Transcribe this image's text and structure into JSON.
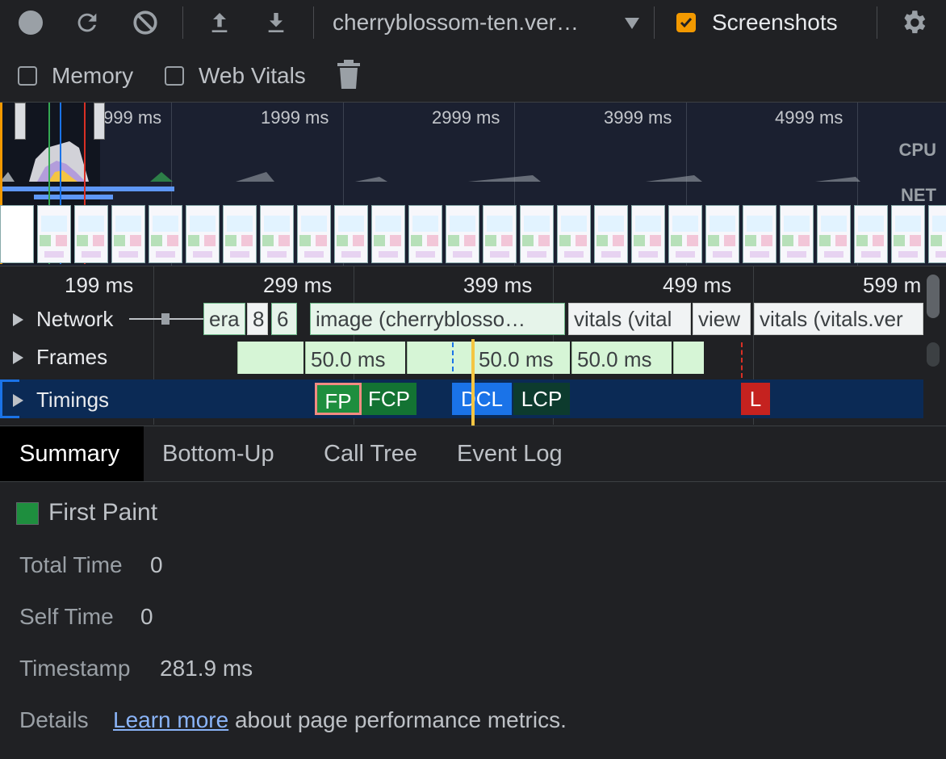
{
  "toolbar": {
    "record_icon": "record-icon",
    "reload_icon": "reload-icon",
    "clear_icon": "clear-icon",
    "upload_icon": "upload-icon",
    "download_icon": "download-icon",
    "profile_select": "cherryblossom-ten.ver…",
    "screenshots_label": "Screenshots",
    "screenshots_checked": true,
    "settings_icon": "gear-icon"
  },
  "toolbar2": {
    "memory_label": "Memory",
    "memory_checked": false,
    "webvitals_label": "Web Vitals",
    "webvitals_checked": false,
    "trash_icon": "trash-icon"
  },
  "overview": {
    "tick_labels": [
      "999 ms",
      "1999 ms",
      "2999 ms",
      "3999 ms",
      "4999 ms"
    ],
    "cpu_label": "CPU",
    "net_label": "NET"
  },
  "ruler": {
    "labels": [
      "199 ms",
      "299 ms",
      "399 ms",
      "499 ms",
      "599 m"
    ]
  },
  "tracks": {
    "network": {
      "title": "Network",
      "blocks": [
        "era",
        "8",
        "6",
        "image (cherryblosso…",
        "vitals (vital",
        "view",
        "vitals (vitals.ver"
      ]
    },
    "frames": {
      "title": "Frames",
      "blocks": [
        "50.0 ms",
        "50.0 ms",
        "50.0 ms"
      ]
    },
    "timings": {
      "title": "Timings",
      "markers": [
        "FP",
        "FCP",
        "DCL",
        "LCP",
        "L"
      ]
    }
  },
  "tabs": [
    "Summary",
    "Bottom-Up",
    "Call Tree",
    "Event Log"
  ],
  "active_tab": "Summary",
  "summary": {
    "event_name": "First Paint",
    "event_color": "#1e8e3e",
    "total_time_label": "Total Time",
    "total_time_value": "0",
    "self_time_label": "Self Time",
    "self_time_value": "0",
    "timestamp_label": "Timestamp",
    "timestamp_value": "281.9 ms",
    "details_label": "Details",
    "learn_more": "Learn more",
    "details_text": "about page performance metrics."
  },
  "colors": {
    "fp": "#1e8e3e",
    "fcp": "#137333",
    "dcl": "#1a73e8",
    "lcp": "#0d3b2e",
    "load": "#c5221f",
    "checkbox_on": "#f29900",
    "link": "#8ab4f8"
  }
}
